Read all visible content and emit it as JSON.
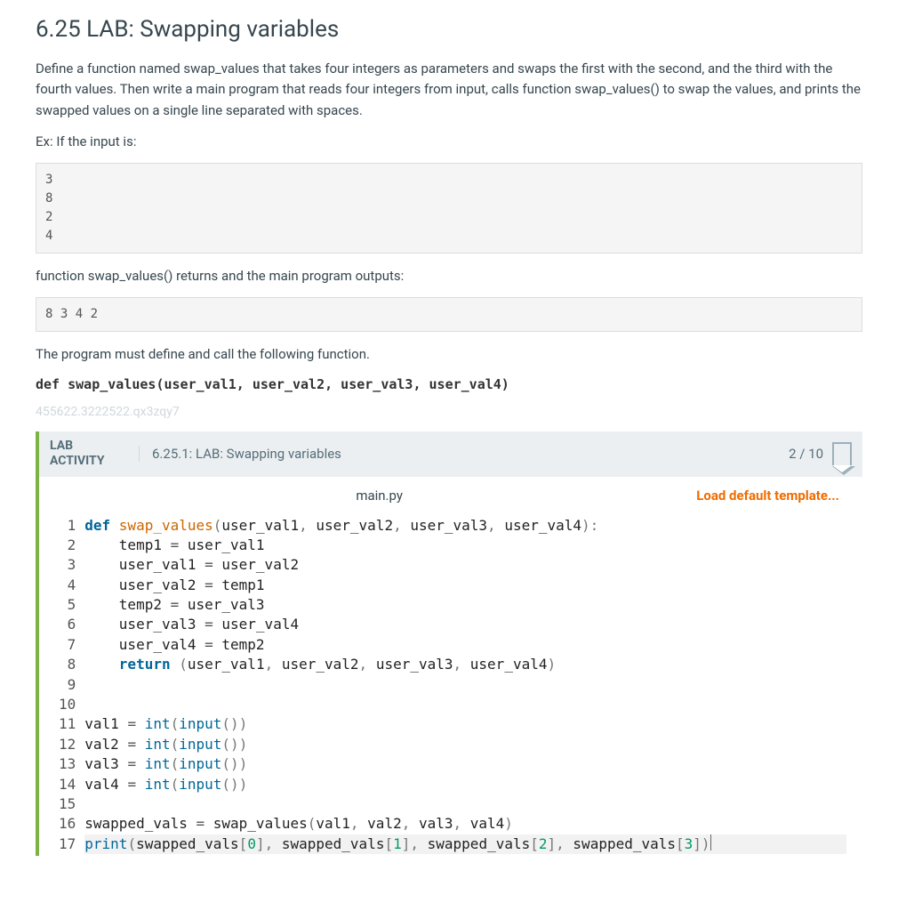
{
  "page": {
    "title": "6.25 LAB: Swapping variables",
    "desc": "Define a function named swap_values that takes four integers as parameters and swaps the first with the second, and the third with the fourth values. Then write a main program that reads four integers from input, calls function swap_values() to swap the values, and prints the swapped values on a single line separated with spaces.",
    "example_intro": "Ex: If the input is:",
    "input_sample": "3\n8\n2\n4",
    "output_intro": "function swap_values() returns and the main program outputs:",
    "output_sample": "8 3 4 2",
    "must_define_line": "The program must define and call the following function.",
    "signature": "def swap_values(user_val1, user_val2, user_val3, user_val4)",
    "hash_id": "455622.3222522.qx3zqy7"
  },
  "activity": {
    "badge_line1": "LAB",
    "badge_line2": "ACTIVITY",
    "title": "6.25.1: LAB: Swapping variables",
    "score": "2 / 10",
    "filename": "main.py",
    "load_template": "Load default template..."
  },
  "code": {
    "lines": [
      {
        "n": "1",
        "tokens": [
          {
            "t": "def ",
            "c": "kw-def"
          },
          {
            "t": "swap_values",
            "c": "fn"
          },
          {
            "t": "(",
            "c": "pr"
          },
          {
            "t": "user_val1",
            "c": "plain"
          },
          {
            "t": ", ",
            "c": "pr"
          },
          {
            "t": "user_val2",
            "c": "plain"
          },
          {
            "t": ", ",
            "c": "pr"
          },
          {
            "t": "user_val3",
            "c": "plain"
          },
          {
            "t": ", ",
            "c": "pr"
          },
          {
            "t": "user_val4",
            "c": "plain"
          },
          {
            "t": ")",
            "c": "pr"
          },
          {
            "t": ":",
            "c": "pr"
          }
        ]
      },
      {
        "n": "2",
        "indent": "    ",
        "tokens": [
          {
            "t": "temp1 ",
            "c": "plain"
          },
          {
            "t": "= ",
            "c": "op"
          },
          {
            "t": "user_val1",
            "c": "plain"
          }
        ]
      },
      {
        "n": "3",
        "indent": "    ",
        "tokens": [
          {
            "t": "user_val1 ",
            "c": "plain"
          },
          {
            "t": "= ",
            "c": "op"
          },
          {
            "t": "user_val2",
            "c": "plain"
          }
        ]
      },
      {
        "n": "4",
        "indent": "    ",
        "tokens": [
          {
            "t": "user_val2 ",
            "c": "plain"
          },
          {
            "t": "= ",
            "c": "op"
          },
          {
            "t": "temp1",
            "c": "plain"
          }
        ]
      },
      {
        "n": "5",
        "indent": "    ",
        "tokens": [
          {
            "t": "temp2 ",
            "c": "plain"
          },
          {
            "t": "= ",
            "c": "op"
          },
          {
            "t": "user_val3",
            "c": "plain"
          }
        ]
      },
      {
        "n": "6",
        "indent": "    ",
        "tokens": [
          {
            "t": "user_val3 ",
            "c": "plain"
          },
          {
            "t": "= ",
            "c": "op"
          },
          {
            "t": "user_val4",
            "c": "plain"
          }
        ]
      },
      {
        "n": "7",
        "indent": "    ",
        "tokens": [
          {
            "t": "user_val4 ",
            "c": "plain"
          },
          {
            "t": "= ",
            "c": "op"
          },
          {
            "t": "temp2",
            "c": "plain"
          }
        ]
      },
      {
        "n": "8",
        "indent": "    ",
        "tokens": [
          {
            "t": "return ",
            "c": "kw-ret"
          },
          {
            "t": "(",
            "c": "pr"
          },
          {
            "t": "user_val1",
            "c": "plain"
          },
          {
            "t": ", ",
            "c": "pr"
          },
          {
            "t": "user_val2",
            "c": "plain"
          },
          {
            "t": ", ",
            "c": "pr"
          },
          {
            "t": "user_val3",
            "c": "plain"
          },
          {
            "t": ", ",
            "c": "pr"
          },
          {
            "t": "user_val4",
            "c": "plain"
          },
          {
            "t": ")",
            "c": "pr"
          }
        ]
      },
      {
        "n": "9",
        "tokens": []
      },
      {
        "n": "10",
        "tokens": []
      },
      {
        "n": "11",
        "tokens": [
          {
            "t": "val1 ",
            "c": "plain"
          },
          {
            "t": "= ",
            "c": "op"
          },
          {
            "t": "int",
            "c": "bi"
          },
          {
            "t": "(",
            "c": "pr"
          },
          {
            "t": "input",
            "c": "bi"
          },
          {
            "t": "())",
            "c": "pr"
          }
        ]
      },
      {
        "n": "12",
        "tokens": [
          {
            "t": "val2 ",
            "c": "plain"
          },
          {
            "t": "= ",
            "c": "op"
          },
          {
            "t": "int",
            "c": "bi"
          },
          {
            "t": "(",
            "c": "pr"
          },
          {
            "t": "input",
            "c": "bi"
          },
          {
            "t": "())",
            "c": "pr"
          }
        ]
      },
      {
        "n": "13",
        "tokens": [
          {
            "t": "val3 ",
            "c": "plain"
          },
          {
            "t": "= ",
            "c": "op"
          },
          {
            "t": "int",
            "c": "bi"
          },
          {
            "t": "(",
            "c": "pr"
          },
          {
            "t": "input",
            "c": "bi"
          },
          {
            "t": "())",
            "c": "pr"
          }
        ]
      },
      {
        "n": "14",
        "tokens": [
          {
            "t": "val4 ",
            "c": "plain"
          },
          {
            "t": "= ",
            "c": "op"
          },
          {
            "t": "int",
            "c": "bi"
          },
          {
            "t": "(",
            "c": "pr"
          },
          {
            "t": "input",
            "c": "bi"
          },
          {
            "t": "())",
            "c": "pr"
          }
        ]
      },
      {
        "n": "15",
        "tokens": []
      },
      {
        "n": "16",
        "tokens": [
          {
            "t": "swapped_vals ",
            "c": "plain"
          },
          {
            "t": "= ",
            "c": "op"
          },
          {
            "t": "swap_values",
            "c": "plain"
          },
          {
            "t": "(",
            "c": "pr"
          },
          {
            "t": "val1",
            "c": "plain"
          },
          {
            "t": ", ",
            "c": "pr"
          },
          {
            "t": "val2",
            "c": "plain"
          },
          {
            "t": ", ",
            "c": "pr"
          },
          {
            "t": "val3",
            "c": "plain"
          },
          {
            "t": ", ",
            "c": "pr"
          },
          {
            "t": "val4",
            "c": "plain"
          },
          {
            "t": ")",
            "c": "pr"
          }
        ]
      },
      {
        "n": "17",
        "cursor_line": true,
        "tokens": [
          {
            "t": "print",
            "c": "bi"
          },
          {
            "t": "(",
            "c": "pr"
          },
          {
            "t": "swapped_vals",
            "c": "plain"
          },
          {
            "t": "[",
            "c": "pr"
          },
          {
            "t": "0",
            "c": "num"
          },
          {
            "t": "], ",
            "c": "pr"
          },
          {
            "t": "swapped_vals",
            "c": "plain"
          },
          {
            "t": "[",
            "c": "pr"
          },
          {
            "t": "1",
            "c": "num"
          },
          {
            "t": "], ",
            "c": "pr"
          },
          {
            "t": "swapped_vals",
            "c": "plain"
          },
          {
            "t": "[",
            "c": "pr"
          },
          {
            "t": "2",
            "c": "num"
          },
          {
            "t": "], ",
            "c": "pr"
          },
          {
            "t": "swapped_vals",
            "c": "plain"
          },
          {
            "t": "[",
            "c": "pr"
          },
          {
            "t": "3",
            "c": "num"
          },
          {
            "t": "])",
            "c": "pr"
          }
        ],
        "cursor_after": true
      }
    ]
  }
}
